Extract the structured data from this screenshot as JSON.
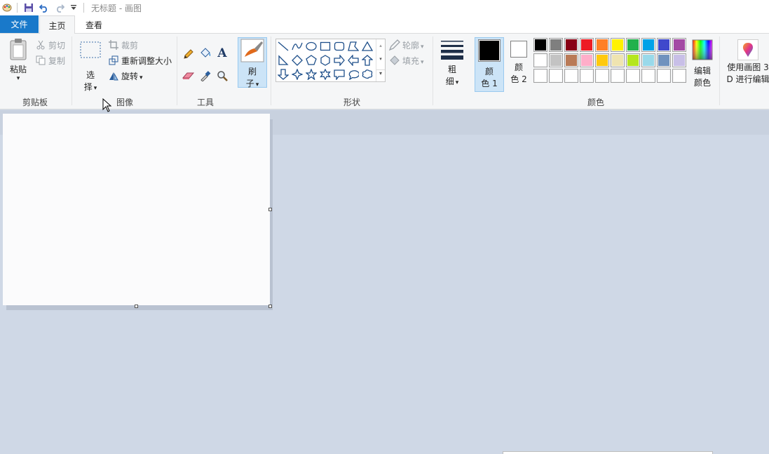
{
  "titlebar": {
    "title": "无标题 - 画图"
  },
  "tabs": {
    "file": "文件",
    "home": "主页",
    "view": "查看"
  },
  "clipboard": {
    "paste": "粘贴",
    "cut": "剪切",
    "copy": "复制",
    "group": "剪贴板"
  },
  "image": {
    "select_line1": "选",
    "select_line2": "择",
    "crop": "裁剪",
    "resize": "重新调整大小",
    "rotate": "旋转",
    "group": "图像"
  },
  "tools": {
    "group": "工具"
  },
  "brush": {
    "line1": "刷",
    "line2": "子"
  },
  "shapes": {
    "outline": "轮廓",
    "fill": "填充",
    "group": "形状"
  },
  "size": {
    "line1": "粗",
    "line2": "细"
  },
  "colors": {
    "color1_line1": "颜",
    "color1_line2": "色 1",
    "color2_line1": "颜",
    "color2_line2": "色 2",
    "edit_line1": "编辑",
    "edit_line2": "颜色",
    "paint3d_line1": "使用画图 3",
    "paint3d_line2": "D 进行编辑",
    "group": "颜色",
    "color1_value": "#000000",
    "color2_value": "#ffffff",
    "palette_row1": [
      "#000000",
      "#7f7f7f",
      "#880015",
      "#ed1c24",
      "#ff7f27",
      "#fff200",
      "#22b14c",
      "#00a2e8",
      "#3f48cc",
      "#a349a4"
    ],
    "palette_row2": [
      "#ffffff",
      "#c3c3c3",
      "#b97a57",
      "#ffaec9",
      "#ffc90e",
      "#efe4b0",
      "#b5e61d",
      "#99d9ea",
      "#7092be",
      "#c8bfe7"
    ],
    "palette_row3": [
      "#ffffff",
      "#ffffff",
      "#ffffff",
      "#ffffff",
      "#ffffff",
      "#ffffff",
      "#ffffff",
      "#ffffff",
      "#ffffff",
      "#ffffff"
    ]
  }
}
